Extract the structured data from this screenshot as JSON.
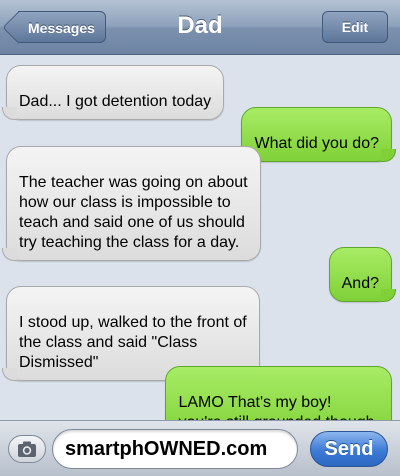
{
  "navbar": {
    "back_label": "Messages",
    "title": "Dad",
    "edit_label": "Edit"
  },
  "messages": [
    {
      "sender": "dad",
      "text": "Dad... I got detention today"
    },
    {
      "sender": "me",
      "text": "What did you do?"
    },
    {
      "sender": "dad",
      "text": "The teacher was going on about\nhow our class is impossible to\nteach and said one of us should\ntry teaching the class for a day."
    },
    {
      "sender": "me",
      "text": "And?"
    },
    {
      "sender": "dad",
      "text": "I stood up, walked to the front of\nthe class and said \"Class\nDismissed\""
    },
    {
      "sender": "me",
      "text": "LAMO That's my boy!\nyou're still grounded though."
    }
  ],
  "input": {
    "value": "smartphOWNED.com",
    "send_label": "Send",
    "camera_icon": "camera-icon"
  },
  "colors": {
    "incoming_bubble": "#dcdcdc",
    "outgoing_bubble": "#8bd743",
    "navbar": "#7b91ae",
    "send_button": "#3d7bd6"
  }
}
